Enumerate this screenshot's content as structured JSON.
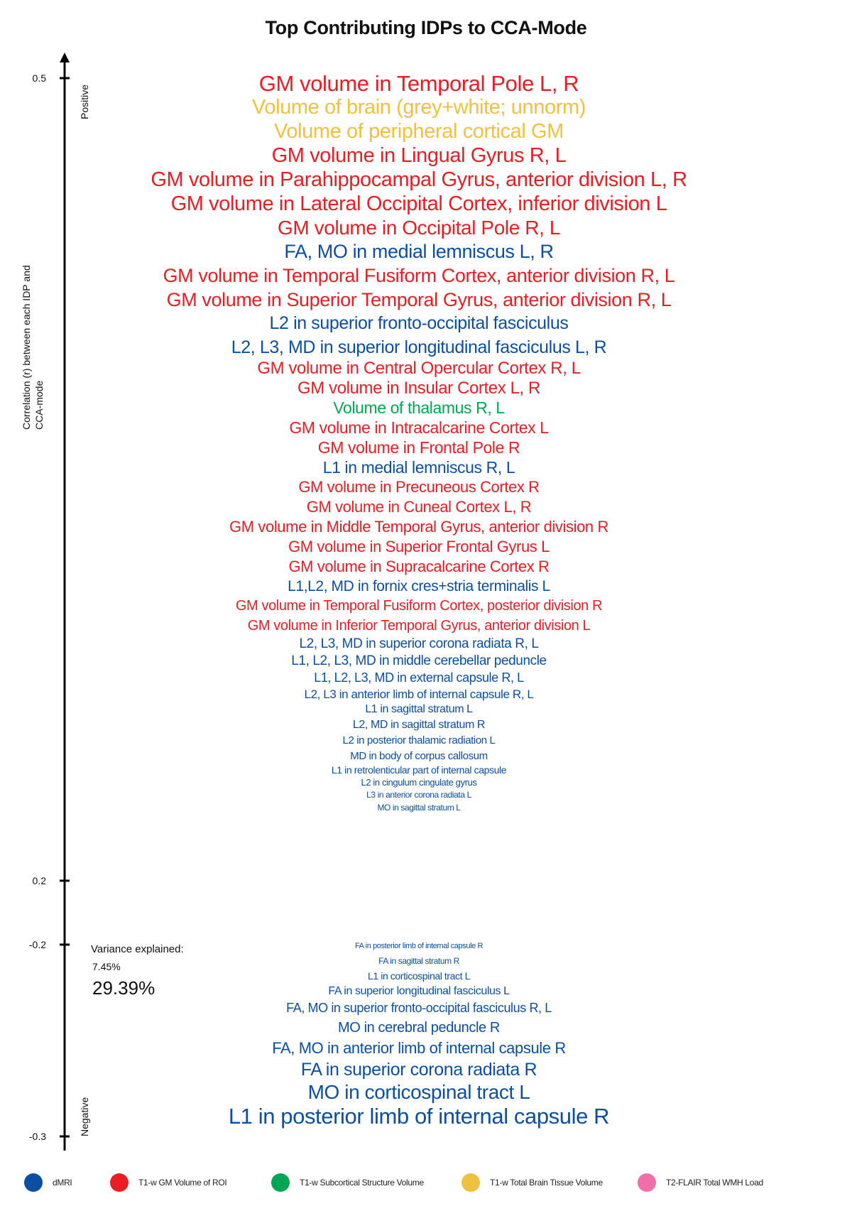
{
  "chart_data": {
    "type": "table",
    "title": "Top Contributing IDPs to CCA-Mode",
    "ylabel": "Correlation (r) between each IDP and CCA-mode",
    "y_ticks": [
      0.5,
      0.2,
      -0.2,
      -0.3
    ],
    "y_tick_labels": [
      "0.5",
      "0.2",
      "-0.2",
      "-0.3"
    ],
    "direction_labels": {
      "positive": "Positive",
      "negative": "Negative"
    },
    "variance_explained": {
      "label": "Variance explained:",
      "small": "7.45%",
      "large": "29.39%"
    },
    "legend": [
      {
        "key": "dmri",
        "label": "dMRI",
        "color": "#0b4ea2"
      },
      {
        "key": "gm",
        "label": "T1-w GM Volume of ROI",
        "color": "#ea1c24"
      },
      {
        "key": "subcortical",
        "label": "T1-w Subcortical Structure Volume",
        "color": "#00a651"
      },
      {
        "key": "total",
        "label": "T1-w Total Brain Tissue Volume",
        "color": "#f0c040"
      },
      {
        "key": "wmh",
        "label": "T2-FLAIR Total WMH Load",
        "color": "#f06ea9"
      }
    ],
    "positive_idps": [
      {
        "text": "GM volume in Temporal Pole L, R",
        "category": "gm"
      },
      {
        "text": "Volume of brain (grey+white; unnorm)",
        "category": "total"
      },
      {
        "text": "Volume of peripheral cortical GM",
        "category": "total"
      },
      {
        "text": "GM volume in Lingual Gyrus R, L",
        "category": "gm"
      },
      {
        "text": "GM volume in Parahippocampal Gyrus, anterior division L, R",
        "category": "gm"
      },
      {
        "text": "GM volume in Lateral Occipital Cortex, inferior division L",
        "category": "gm"
      },
      {
        "text": "GM volume in Occipital Pole R, L",
        "category": "gm"
      },
      {
        "text": "FA, MO in medial lemniscus L, R",
        "category": "dmri"
      },
      {
        "text": "GM volume in Temporal Fusiform Cortex, anterior division R, L",
        "category": "gm"
      },
      {
        "text": "GM volume in Superior Temporal Gyrus, anterior division R, L",
        "category": "gm"
      },
      {
        "text": "L2 in superior fronto-occipital fasciculus",
        "category": "dmri"
      },
      {
        "text": "L2, L3, MD in superior longitudinal fasciculus L, R",
        "category": "dmri"
      },
      {
        "text": "GM volume in Central Opercular Cortex R, L",
        "category": "gm"
      },
      {
        "text": "GM volume in Insular Cortex L, R",
        "category": "gm"
      },
      {
        "text": "Volume of thalamus R, L",
        "category": "subcortical"
      },
      {
        "text": "GM volume in Intracalcarine Cortex L",
        "category": "gm"
      },
      {
        "text": "GM volume in Frontal Pole R",
        "category": "gm"
      },
      {
        "text": "L1 in medial lemniscus R, L",
        "category": "dmri"
      },
      {
        "text": "GM volume in Precuneous Cortex R",
        "category": "gm"
      },
      {
        "text": "GM volume in Cuneal Cortex L, R",
        "category": "gm"
      },
      {
        "text": "GM volume in Middle Temporal Gyrus, anterior division R",
        "category": "gm"
      },
      {
        "text": "GM volume in Superior Frontal Gyrus L",
        "category": "gm"
      },
      {
        "text": "GM volume in Supracalcarine Cortex R",
        "category": "gm"
      },
      {
        "text": "L1,L2, MD in fornix cres+stria terminalis L",
        "category": "dmri"
      },
      {
        "text": "GM volume in Temporal Fusiform Cortex, posterior division R",
        "category": "gm"
      },
      {
        "text": "GM volume in Inferior Temporal Gyrus, anterior division L",
        "category": "gm"
      },
      {
        "text": "L2, L3, MD in superior corona radiata R, L",
        "category": "dmri"
      },
      {
        "text": "L1, L2, L3, MD in middle cerebellar peduncle",
        "category": "dmri"
      },
      {
        "text": "L1, L2, L3, MD in external capsule R, L",
        "category": "dmri"
      },
      {
        "text": "L2, L3 in anterior limb of internal capsule R, L",
        "category": "dmri"
      },
      {
        "text": "L1 in sagittal stratum L",
        "category": "dmri"
      },
      {
        "text": "L2, MD in sagittal stratum R",
        "category": "dmri"
      },
      {
        "text": "L2 in posterior thalamic radiation L",
        "category": "dmri"
      },
      {
        "text": "MD in body of corpus callosum",
        "category": "dmri"
      },
      {
        "text": "L1 in retrolenticular part of internal capsule",
        "category": "dmri"
      },
      {
        "text": "L2 in cingulum cingulate gyrus",
        "category": "dmri"
      },
      {
        "text": "L3 in anterior corona radiata L",
        "category": "dmri"
      },
      {
        "text": "MO in sagittal stratum L",
        "category": "dmri"
      }
    ],
    "negative_idps": [
      {
        "text": "FA in posterior limb of internal capsule R",
        "category": "dmri"
      },
      {
        "text": "FA in sagittal stratum R",
        "category": "dmri"
      },
      {
        "text": "L1 in corticospinal tract L",
        "category": "dmri"
      },
      {
        "text": "FA in superior longitudinal fasciculus L",
        "category": "dmri"
      },
      {
        "text": "FA, MO in superior fronto-occipital fasciculus R, L",
        "category": "dmri"
      },
      {
        "text": "MO in cerebral peduncle R",
        "category": "dmri"
      },
      {
        "text": "FA, MO in anterior limb of internal capsule R",
        "category": "dmri"
      },
      {
        "text": "FA in superior corona radiata R",
        "category": "dmri"
      },
      {
        "text": "MO in corticospinal tract L",
        "category": "dmri"
      },
      {
        "text": "L1 in posterior limb of internal capsule R",
        "category": "dmri"
      }
    ]
  }
}
